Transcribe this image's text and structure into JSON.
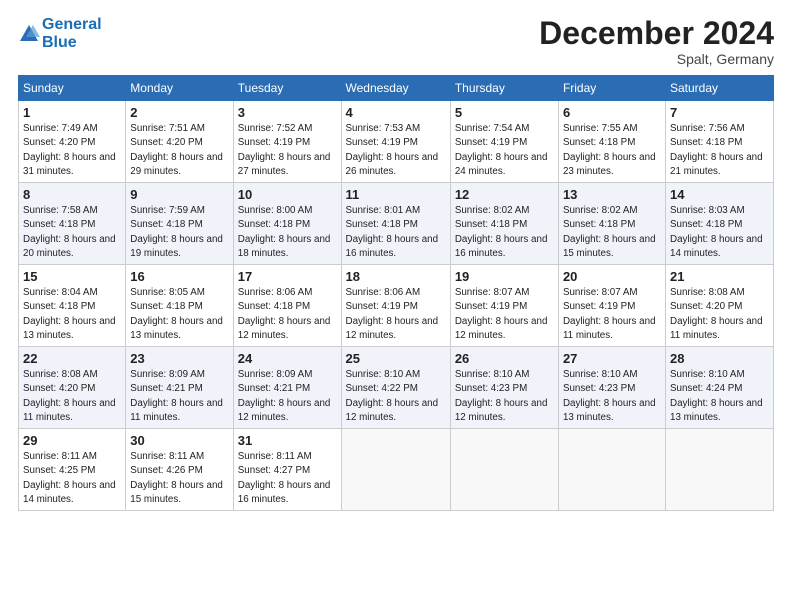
{
  "header": {
    "logo_line1": "General",
    "logo_line2": "Blue",
    "month": "December 2024",
    "location": "Spalt, Germany"
  },
  "weekdays": [
    "Sunday",
    "Monday",
    "Tuesday",
    "Wednesday",
    "Thursday",
    "Friday",
    "Saturday"
  ],
  "weeks": [
    [
      {
        "day": "1",
        "sunrise": "7:49 AM",
        "sunset": "4:20 PM",
        "daylight": "8 hours and 31 minutes."
      },
      {
        "day": "2",
        "sunrise": "7:51 AM",
        "sunset": "4:20 PM",
        "daylight": "8 hours and 29 minutes."
      },
      {
        "day": "3",
        "sunrise": "7:52 AM",
        "sunset": "4:19 PM",
        "daylight": "8 hours and 27 minutes."
      },
      {
        "day": "4",
        "sunrise": "7:53 AM",
        "sunset": "4:19 PM",
        "daylight": "8 hours and 26 minutes."
      },
      {
        "day": "5",
        "sunrise": "7:54 AM",
        "sunset": "4:19 PM",
        "daylight": "8 hours and 24 minutes."
      },
      {
        "day": "6",
        "sunrise": "7:55 AM",
        "sunset": "4:18 PM",
        "daylight": "8 hours and 23 minutes."
      },
      {
        "day": "7",
        "sunrise": "7:56 AM",
        "sunset": "4:18 PM",
        "daylight": "8 hours and 21 minutes."
      }
    ],
    [
      {
        "day": "8",
        "sunrise": "7:58 AM",
        "sunset": "4:18 PM",
        "daylight": "8 hours and 20 minutes."
      },
      {
        "day": "9",
        "sunrise": "7:59 AM",
        "sunset": "4:18 PM",
        "daylight": "8 hours and 19 minutes."
      },
      {
        "day": "10",
        "sunrise": "8:00 AM",
        "sunset": "4:18 PM",
        "daylight": "8 hours and 18 minutes."
      },
      {
        "day": "11",
        "sunrise": "8:01 AM",
        "sunset": "4:18 PM",
        "daylight": "8 hours and 16 minutes."
      },
      {
        "day": "12",
        "sunrise": "8:02 AM",
        "sunset": "4:18 PM",
        "daylight": "8 hours and 16 minutes."
      },
      {
        "day": "13",
        "sunrise": "8:02 AM",
        "sunset": "4:18 PM",
        "daylight": "8 hours and 15 minutes."
      },
      {
        "day": "14",
        "sunrise": "8:03 AM",
        "sunset": "4:18 PM",
        "daylight": "8 hours and 14 minutes."
      }
    ],
    [
      {
        "day": "15",
        "sunrise": "8:04 AM",
        "sunset": "4:18 PM",
        "daylight": "8 hours and 13 minutes."
      },
      {
        "day": "16",
        "sunrise": "8:05 AM",
        "sunset": "4:18 PM",
        "daylight": "8 hours and 13 minutes."
      },
      {
        "day": "17",
        "sunrise": "8:06 AM",
        "sunset": "4:18 PM",
        "daylight": "8 hours and 12 minutes."
      },
      {
        "day": "18",
        "sunrise": "8:06 AM",
        "sunset": "4:19 PM",
        "daylight": "8 hours and 12 minutes."
      },
      {
        "day": "19",
        "sunrise": "8:07 AM",
        "sunset": "4:19 PM",
        "daylight": "8 hours and 12 minutes."
      },
      {
        "day": "20",
        "sunrise": "8:07 AM",
        "sunset": "4:19 PM",
        "daylight": "8 hours and 11 minutes."
      },
      {
        "day": "21",
        "sunrise": "8:08 AM",
        "sunset": "4:20 PM",
        "daylight": "8 hours and 11 minutes."
      }
    ],
    [
      {
        "day": "22",
        "sunrise": "8:08 AM",
        "sunset": "4:20 PM",
        "daylight": "8 hours and 11 minutes."
      },
      {
        "day": "23",
        "sunrise": "8:09 AM",
        "sunset": "4:21 PM",
        "daylight": "8 hours and 11 minutes."
      },
      {
        "day": "24",
        "sunrise": "8:09 AM",
        "sunset": "4:21 PM",
        "daylight": "8 hours and 12 minutes."
      },
      {
        "day": "25",
        "sunrise": "8:10 AM",
        "sunset": "4:22 PM",
        "daylight": "8 hours and 12 minutes."
      },
      {
        "day": "26",
        "sunrise": "8:10 AM",
        "sunset": "4:23 PM",
        "daylight": "8 hours and 12 minutes."
      },
      {
        "day": "27",
        "sunrise": "8:10 AM",
        "sunset": "4:23 PM",
        "daylight": "8 hours and 13 minutes."
      },
      {
        "day": "28",
        "sunrise": "8:10 AM",
        "sunset": "4:24 PM",
        "daylight": "8 hours and 13 minutes."
      }
    ],
    [
      {
        "day": "29",
        "sunrise": "8:11 AM",
        "sunset": "4:25 PM",
        "daylight": "8 hours and 14 minutes."
      },
      {
        "day": "30",
        "sunrise": "8:11 AM",
        "sunset": "4:26 PM",
        "daylight": "8 hours and 15 minutes."
      },
      {
        "day": "31",
        "sunrise": "8:11 AM",
        "sunset": "4:27 PM",
        "daylight": "8 hours and 16 minutes."
      },
      null,
      null,
      null,
      null
    ]
  ]
}
